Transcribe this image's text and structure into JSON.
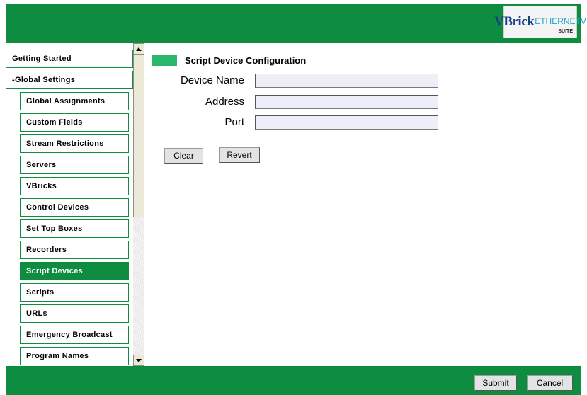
{
  "logo": {
    "brand": "VBrick",
    "product": "ETHERNETV",
    "suite": "SUITE"
  },
  "sidebar": {
    "items": [
      {
        "label": "Getting Started",
        "active": false
      },
      {
        "label": "-Global Settings",
        "active": false
      },
      {
        "label": "Global Assignments",
        "active": false
      },
      {
        "label": "Custom Fields",
        "active": false
      },
      {
        "label": "Stream Restrictions",
        "active": false
      },
      {
        "label": "Servers",
        "active": false
      },
      {
        "label": "VBricks",
        "active": false
      },
      {
        "label": "Control Devices",
        "active": false
      },
      {
        "label": "Set Top Boxes",
        "active": false
      },
      {
        "label": "Recorders",
        "active": false
      },
      {
        "label": "Script Devices",
        "active": true
      },
      {
        "label": "Scripts",
        "active": false
      },
      {
        "label": "URLs",
        "active": false
      },
      {
        "label": "Emergency Broadcast",
        "active": false
      },
      {
        "label": "Program Names",
        "active": false
      }
    ]
  },
  "main": {
    "title": "Script Device Configuration",
    "fields": {
      "device_name": {
        "label": "Device Name",
        "value": ""
      },
      "address": {
        "label": "Address",
        "value": ""
      },
      "port": {
        "label": "Port",
        "value": ""
      }
    },
    "buttons": {
      "clear": "Clear",
      "revert": "Revert"
    }
  },
  "footer": {
    "submit": "Submit",
    "cancel": "Cancel"
  },
  "colors": {
    "brand_green": "#0e8c3f",
    "marker_green": "#2ab66b",
    "input_bg": "#eeeef8"
  }
}
